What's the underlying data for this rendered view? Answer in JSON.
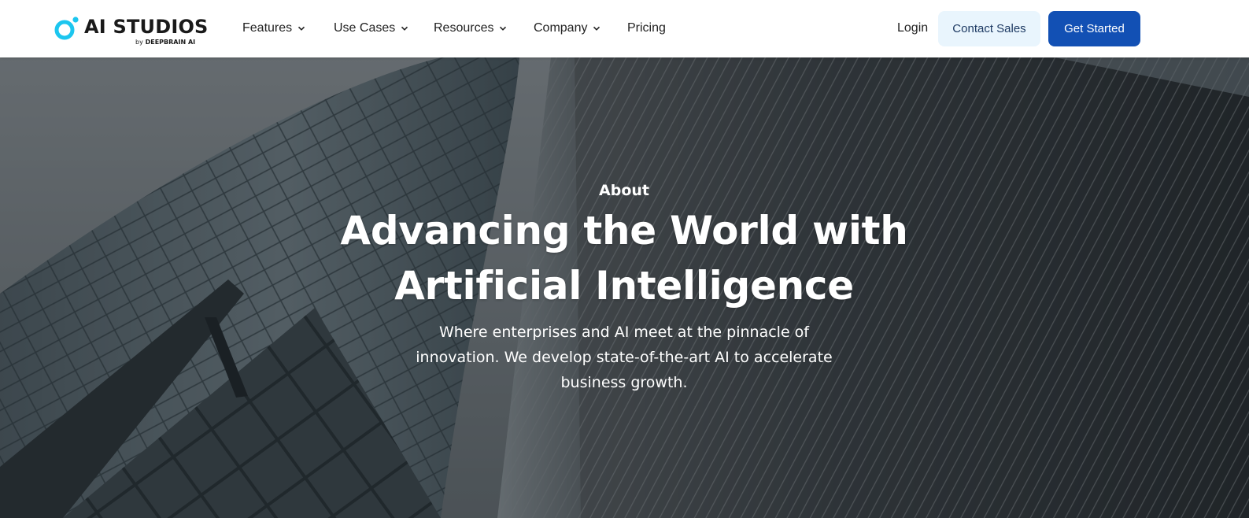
{
  "brand": {
    "name": "AI STUDIOS",
    "byline_prefix": "by",
    "byline_brand": "DEEPBRAIN AI",
    "accent_color": "#1cc6ef"
  },
  "nav": {
    "items": [
      {
        "label": "Features",
        "has_dropdown": true
      },
      {
        "label": "Use Cases",
        "has_dropdown": true
      },
      {
        "label": "Resources",
        "has_dropdown": true
      },
      {
        "label": "Company",
        "has_dropdown": true
      },
      {
        "label": "Pricing",
        "has_dropdown": false
      }
    ],
    "login_label": "Login",
    "contact_sales_label": "Contact Sales",
    "get_started_label": "Get Started",
    "primary_color": "#1250b4",
    "secondary_bg_color": "#e9f5fd"
  },
  "hero": {
    "eyebrow": "About",
    "headline_line1": "Advancing the World with",
    "headline_line2": "Artificial Intelligence",
    "subtext_line1": "Where enterprises and AI meet at the pinnacle of",
    "subtext_line2": "innovation. We develop state-of-the-art AI to accelerate",
    "subtext_line3": "business growth.",
    "background": "skyscrapers-photo"
  }
}
